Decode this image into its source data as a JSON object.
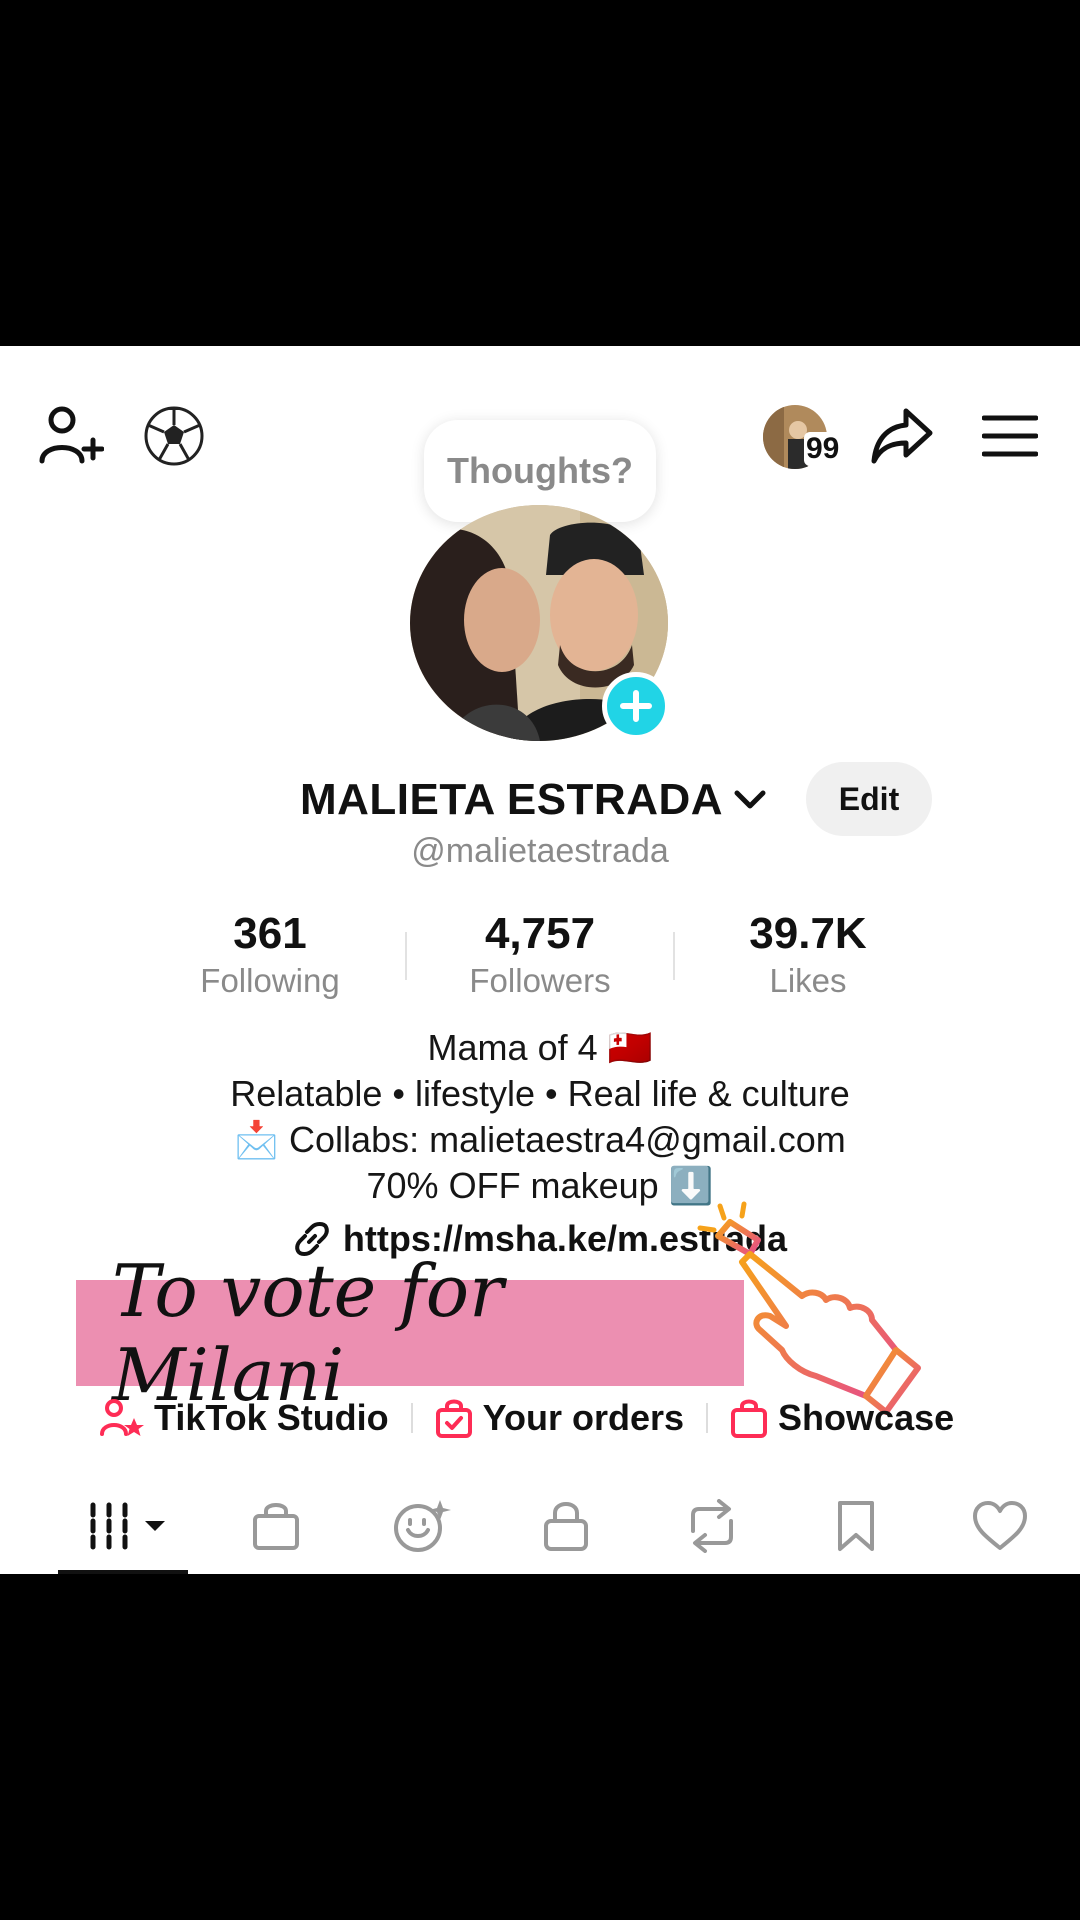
{
  "tooltip": {
    "text": "Thoughts?"
  },
  "header": {
    "notification_count": "99"
  },
  "profile": {
    "display_name": "MALIETA ESTRADA",
    "username": "@malietaestrada",
    "edit_label": "Edit"
  },
  "stats": [
    {
      "value": "361",
      "label": "Following"
    },
    {
      "value": "4,757",
      "label": "Followers"
    },
    {
      "value": "39.7K",
      "label": "Likes"
    }
  ],
  "bio": {
    "line1": "Mama of 4 🇹🇴",
    "line2": "Relatable • lifestyle • Real life & culture",
    "line3": "📩 Collabs: malietaestra4@gmail.com",
    "line4": "70% OFF makeup ⬇️",
    "link": "https://msha.ke/m.estrada"
  },
  "overlay": {
    "text": "To vote for Milani"
  },
  "quick_links": [
    {
      "label": "TikTok Studio"
    },
    {
      "label": "Your orders"
    },
    {
      "label": "Showcase"
    }
  ],
  "colors": {
    "accent_cyan": "#21d4e6",
    "pink_band": "#ec8fb1",
    "tiktok_red": "#fe2c55"
  }
}
